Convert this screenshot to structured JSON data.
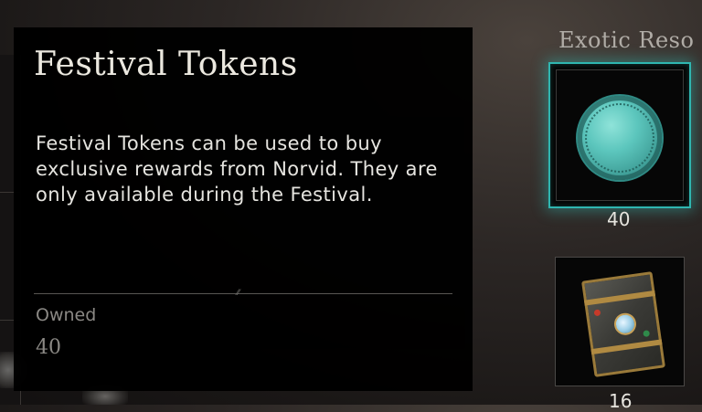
{
  "tooltip": {
    "title": "Festival Tokens",
    "description": "Festival Tokens can be used to buy exclusive rewards from Norvid. They are only available during the Festival.",
    "owned_label": "Owned",
    "owned_value": "40"
  },
  "inventory": {
    "section_title": "Exotic Reso",
    "items": [
      {
        "icon": "festival-token-icon",
        "count": "40",
        "selected": true
      },
      {
        "icon": "ornate-book-icon",
        "count": "16",
        "selected": false
      }
    ]
  },
  "colors": {
    "accent": "#2fb6b0",
    "tooltip_bg": "#000000",
    "muted_text": "#8e8c88"
  }
}
